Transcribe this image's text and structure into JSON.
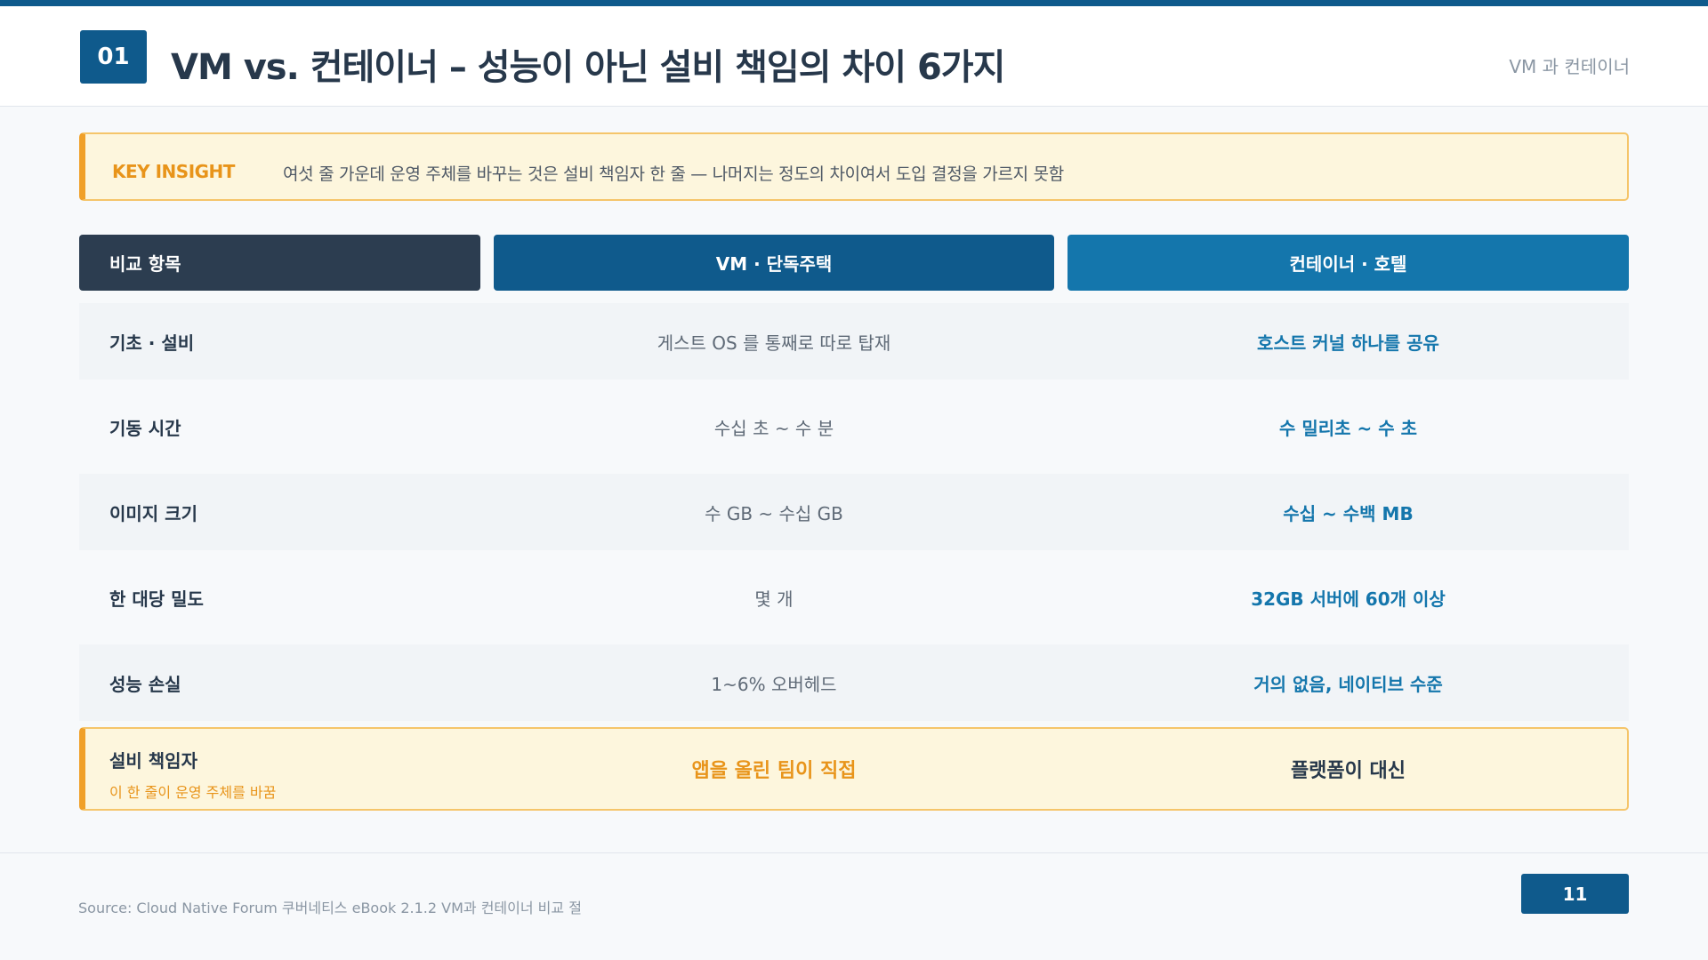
{
  "header": {
    "chapter_number": "01",
    "title": "VM vs. 컨테이너 – 성능이 아닌 설비 책임의 차이 6가지",
    "section": "VM 과 컨테이너"
  },
  "insight": {
    "tag": "KEY INSIGHT",
    "text": "여섯 줄 가운데 운영 주체를 바꾸는 것은 설비 책임자 한 줄 — 나머지는 정도의 차이여서 도입 결정을 가르지 못함"
  },
  "table": {
    "columns": [
      "비교 항목",
      "VM · 단독주택",
      "컨테이너 · 호텔"
    ],
    "rows": [
      {
        "label": "기초 · 설비",
        "vm": "게스트 OS 를 통째로 따로 탑재",
        "container": "호스트 커널 하나를 공유"
      },
      {
        "label": "기동 시간",
        "vm": "수십 초 ~ 수 분",
        "container": "수 밀리초 ~ 수 초"
      },
      {
        "label": "이미지 크기",
        "vm": "수 GB ~ 수십 GB",
        "container": "수십 ~ 수백 MB"
      },
      {
        "label": "한 대당 밀도",
        "vm": "몇 개",
        "container": "32GB 서버에 60개 이상"
      },
      {
        "label": "성능 손실",
        "vm": "1~6% 오버헤드",
        "container": "거의 없음, 네이티브 수준"
      },
      {
        "label": "설비 책임자",
        "note": "이 한 줄이 운영 주체를 바꿈",
        "vm": "앱을 올린 팀이 직접",
        "container": "플랫폼이 대신"
      }
    ]
  },
  "footer": {
    "source": "Source: Cloud Native Forum 쿠버네티스 eBook 2.1.2 VM과 컨테이너 비교 절",
    "page": "11"
  },
  "colors": {
    "primary": "#0f5a8c",
    "secondary": "#1476ac",
    "dark": "#2c3d50",
    "accent": "#f0a028",
    "accent_bg": "#fdf6dd"
  }
}
